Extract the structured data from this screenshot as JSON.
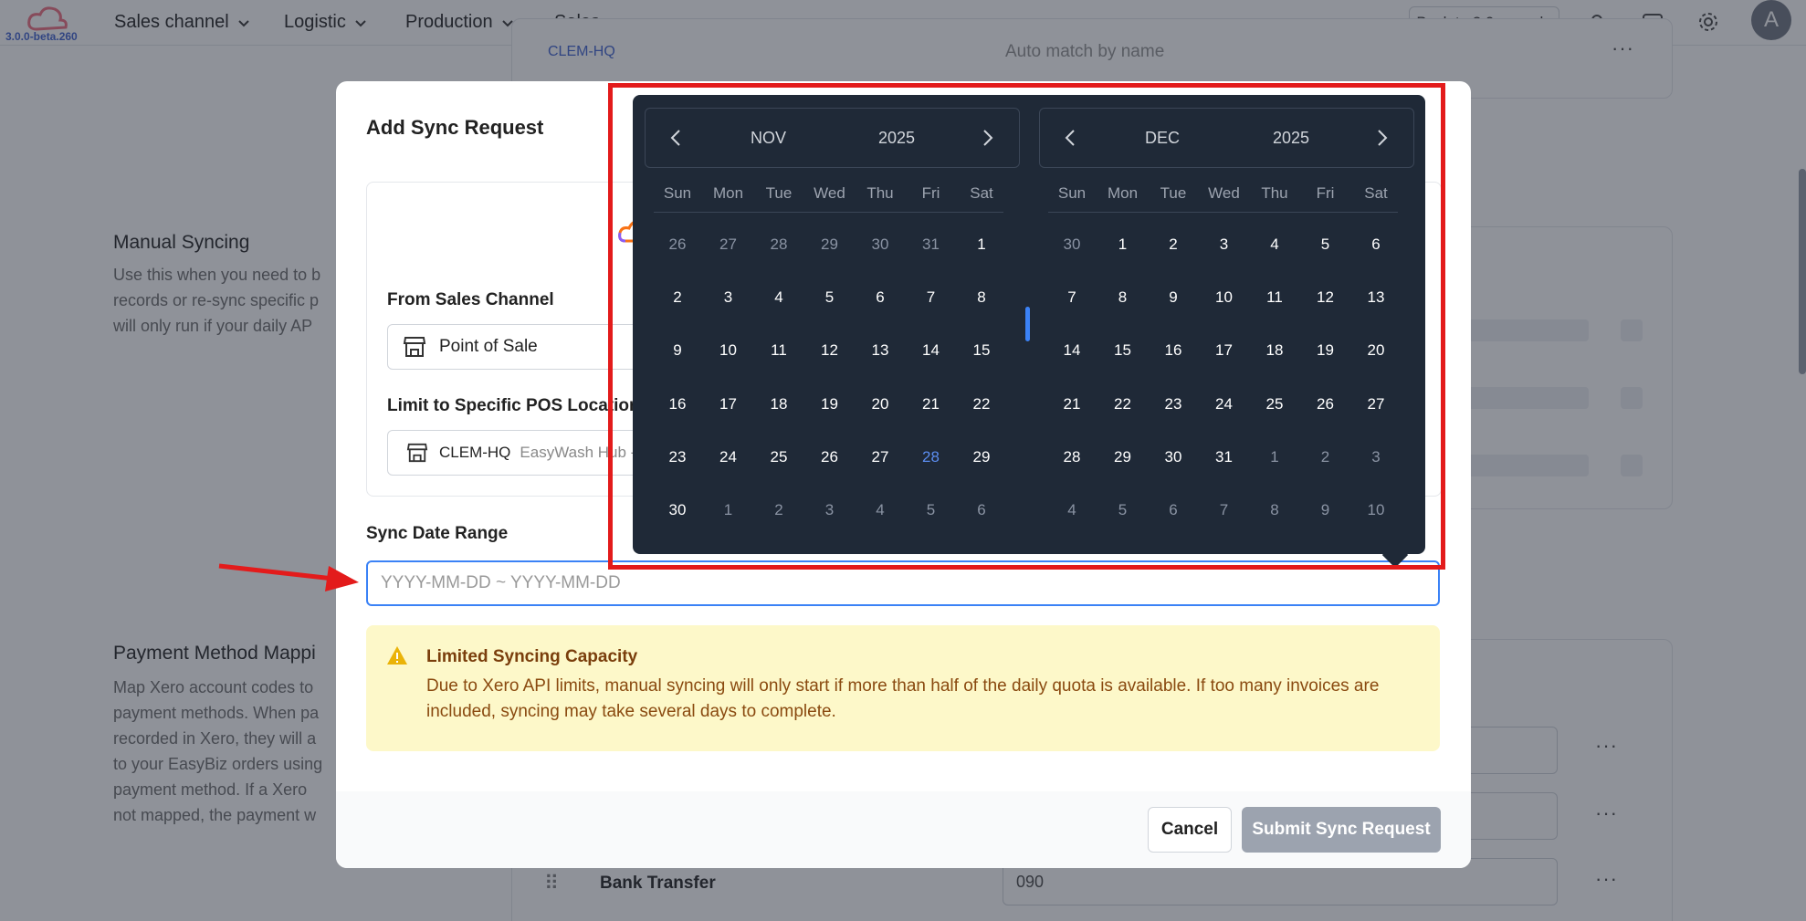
{
  "app": {
    "version": "3.0.0-beta.260"
  },
  "nav": {
    "items": [
      {
        "label": "Sales channel"
      },
      {
        "label": "Logistic"
      },
      {
        "label": "Production"
      },
      {
        "label": "Sales"
      }
    ],
    "back_label": "Back to 2.0 console",
    "avatar_letter": "A"
  },
  "background": {
    "top_location_tag": "CLEM-HQ",
    "top_match_text": "Auto match by name",
    "manual_syncing": {
      "title": "Manual Syncing",
      "desc": [
        "Use this when you need to b",
        "records or re-sync specific p",
        "will only run if your daily AP"
      ]
    },
    "payment_mapping": {
      "title": "Payment Method Mappi",
      "desc": [
        "Map Xero account codes to",
        "payment methods. When pa",
        "recorded in Xero, they will a",
        "to your EasyBiz orders using",
        "payment method. If a Xero",
        "not mapped, the payment w"
      ]
    },
    "bank_row": {
      "label": "Bank Transfer",
      "code": "090"
    }
  },
  "modal": {
    "title": "Add Sync Request",
    "from_label": "From Sales Channel",
    "from_value": "Point of Sale",
    "limit_label": "Limit to Specific POS Location",
    "location_code": "CLEM-HQ",
    "location_name": "EasyWash Hub -",
    "range_label": "Sync Date Range",
    "range_placeholder": "YYYY-MM-DD ~ YYYY-MM-DD",
    "alert": {
      "title": "Limited Syncing Capacity",
      "text": "Due to Xero API limits, manual syncing will only start if more than half of the daily quota is available. If too many invoices are included, syncing may take several days to complete."
    },
    "cancel_label": "Cancel",
    "submit_label": "Submit Sync Request"
  },
  "calendar": {
    "weekdays": [
      "Sun",
      "Mon",
      "Tue",
      "Wed",
      "Thu",
      "Fri",
      "Sat"
    ],
    "months": [
      {
        "month": "NOV",
        "year": "2025",
        "today": "28",
        "weeks": [
          [
            [
              "26",
              0
            ],
            [
              "27",
              0
            ],
            [
              "28",
              0
            ],
            [
              "29",
              0
            ],
            [
              "30",
              0
            ],
            [
              "31",
              0
            ],
            [
              "1",
              1
            ]
          ],
          [
            [
              "2",
              1
            ],
            [
              "3",
              1
            ],
            [
              "4",
              1
            ],
            [
              "5",
              1
            ],
            [
              "6",
              1
            ],
            [
              "7",
              1
            ],
            [
              "8",
              1
            ]
          ],
          [
            [
              "9",
              1
            ],
            [
              "10",
              1
            ],
            [
              "11",
              1
            ],
            [
              "12",
              1
            ],
            [
              "13",
              1
            ],
            [
              "14",
              1
            ],
            [
              "15",
              1
            ]
          ],
          [
            [
              "16",
              1
            ],
            [
              "17",
              1
            ],
            [
              "18",
              1
            ],
            [
              "19",
              1
            ],
            [
              "20",
              1
            ],
            [
              "21",
              1
            ],
            [
              "22",
              1
            ]
          ],
          [
            [
              "23",
              1
            ],
            [
              "24",
              1
            ],
            [
              "25",
              1
            ],
            [
              "26",
              1
            ],
            [
              "27",
              1
            ],
            [
              "28",
              2
            ],
            [
              "29",
              1
            ]
          ],
          [
            [
              "30",
              1
            ],
            [
              "1",
              0
            ],
            [
              "2",
              0
            ],
            [
              "3",
              0
            ],
            [
              "4",
              0
            ],
            [
              "5",
              0
            ],
            [
              "6",
              0
            ]
          ]
        ]
      },
      {
        "month": "DEC",
        "year": "2025",
        "weeks": [
          [
            [
              "30",
              0
            ],
            [
              "1",
              1
            ],
            [
              "2",
              1
            ],
            [
              "3",
              1
            ],
            [
              "4",
              1
            ],
            [
              "5",
              1
            ],
            [
              "6",
              1
            ]
          ],
          [
            [
              "7",
              1
            ],
            [
              "8",
              1
            ],
            [
              "9",
              1
            ],
            [
              "10",
              1
            ],
            [
              "11",
              1
            ],
            [
              "12",
              1
            ],
            [
              "13",
              1
            ]
          ],
          [
            [
              "14",
              1
            ],
            [
              "15",
              1
            ],
            [
              "16",
              1
            ],
            [
              "17",
              1
            ],
            [
              "18",
              1
            ],
            [
              "19",
              1
            ],
            [
              "20",
              1
            ]
          ],
          [
            [
              "21",
              1
            ],
            [
              "22",
              1
            ],
            [
              "23",
              1
            ],
            [
              "24",
              1
            ],
            [
              "25",
              1
            ],
            [
              "26",
              1
            ],
            [
              "27",
              1
            ]
          ],
          [
            [
              "28",
              1
            ],
            [
              "29",
              1
            ],
            [
              "30",
              1
            ],
            [
              "31",
              1
            ],
            [
              "1",
              0
            ],
            [
              "2",
              0
            ],
            [
              "3",
              0
            ]
          ],
          [
            [
              "4",
              0
            ],
            [
              "5",
              0
            ],
            [
              "6",
              0
            ],
            [
              "7",
              0
            ],
            [
              "8",
              0
            ],
            [
              "9",
              0
            ],
            [
              "10",
              0
            ]
          ]
        ]
      }
    ]
  },
  "colors": {
    "accent": "#3b82f6",
    "calendar_bg": "#1f2937",
    "annotation": "#e31b1b",
    "alert_bg": "#fdf8c9"
  }
}
